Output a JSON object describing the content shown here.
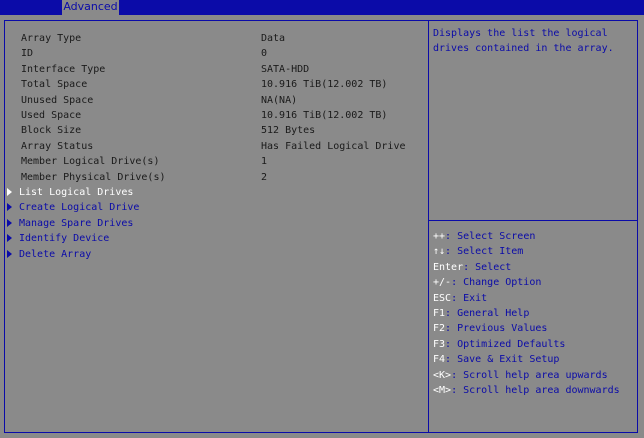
{
  "tabs": [
    {
      "label": "Advanced",
      "active": true
    }
  ],
  "info_rows": [
    {
      "label": "Array Type",
      "value": "Data"
    },
    {
      "label": "ID",
      "value": "0"
    },
    {
      "label": "Interface Type",
      "value": "SATA-HDD"
    },
    {
      "label": "Total Space",
      "value": "10.916 TiB(12.002 TB)"
    },
    {
      "label": "Unused Space",
      "value": "NA(NA)"
    },
    {
      "label": "Used Space",
      "value": "10.916 TiB(12.002 TB)"
    },
    {
      "label": "Block Size",
      "value": "512 Bytes"
    },
    {
      "label": "Array Status",
      "value": "Has Failed Logical Drive"
    },
    {
      "label": "Member Logical Drive(s)",
      "value": "1"
    },
    {
      "label": "Member Physical Drive(s)",
      "value": "2"
    }
  ],
  "menu_items": [
    {
      "label": "List Logical Drives",
      "selected": true
    },
    {
      "label": "Create Logical Drive",
      "selected": false
    },
    {
      "label": "Manage Spare Drives",
      "selected": false
    },
    {
      "label": "Identify Device",
      "selected": false
    },
    {
      "label": "Delete Array",
      "selected": false
    }
  ],
  "help": {
    "description": "Displays the list the logical drives contained in the array."
  },
  "key_help": [
    {
      "key": "++",
      "text": ": Select Screen"
    },
    {
      "key": "↑↓",
      "text": ": Select Item"
    },
    {
      "key": "Enter",
      "text": ": Select"
    },
    {
      "key": "+/-",
      "text": ": Change Option"
    },
    {
      "key": "ESC",
      "text": ": Exit"
    },
    {
      "key": "F1",
      "text": ": General Help"
    },
    {
      "key": "F2",
      "text": ": Previous Values"
    },
    {
      "key": "F3",
      "text": ": Optimized Defaults"
    },
    {
      "key": "F4",
      "text": ": Save & Exit Setup"
    },
    {
      "key": "<K>",
      "text": ": Scroll help area upwards"
    },
    {
      "key": "<M>",
      "text": ": Scroll help area downwards"
    }
  ],
  "colors": {
    "bios_blue": "#0b0ba8",
    "panel_gray": "#8a8a8a",
    "selected_text": "#ffffff",
    "static_text": "#1a1a1a"
  }
}
